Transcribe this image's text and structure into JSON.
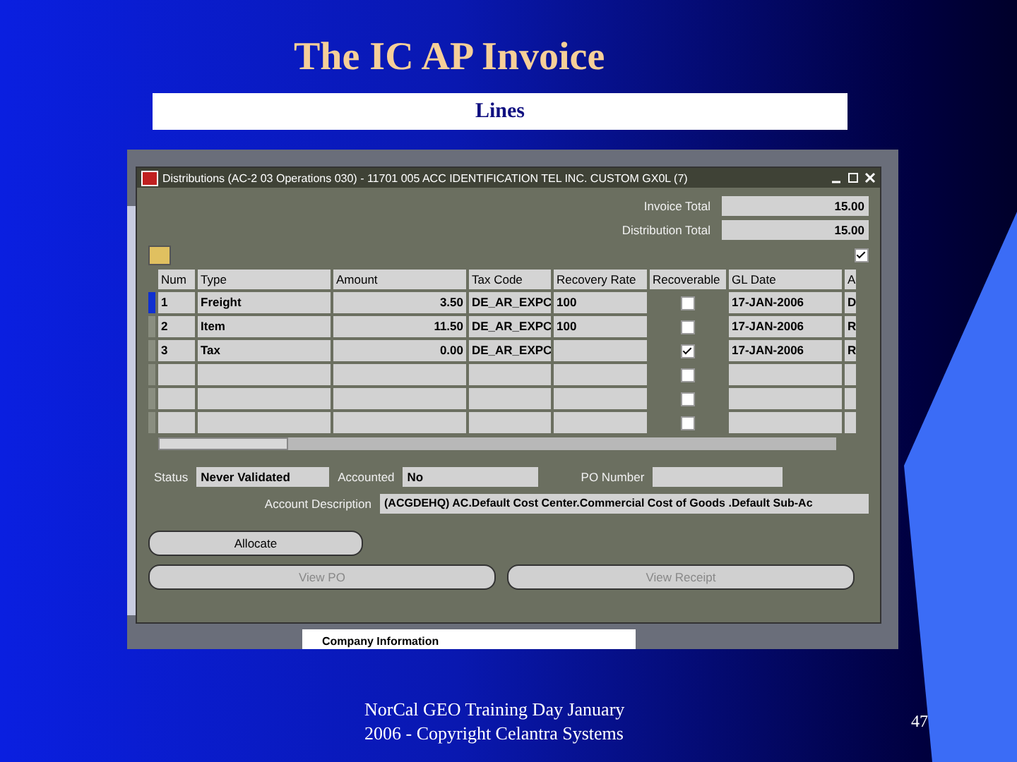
{
  "slide": {
    "title": "The IC AP Invoice",
    "subtitle": "Lines",
    "footer_lines": [
      "NorCal GEO Training Day January",
      "2006 -  Copyright Celantra Systems"
    ],
    "page_number": "47"
  },
  "background_app": {
    "tree_item": "Company Information"
  },
  "window": {
    "title": "Distributions (AC-2 03 Operations 030) - 11701 005 ACC IDENTIFICATION TEL INC. CUSTOM GX0L (7)",
    "totals": [
      {
        "label": "Invoice Total",
        "value": "15.00"
      },
      {
        "label": "Distribution Total",
        "value": "15.00"
      }
    ],
    "header_checked": true
  },
  "table": {
    "columns": [
      "Num",
      "Type",
      "Amount",
      "Tax Code",
      "Recovery Rate",
      "Recoverable",
      "GL Date",
      "A"
    ],
    "rows": [
      {
        "num": "1",
        "type": "Freight",
        "amount": "3.50",
        "tax_code": "DE_AR_EXPC",
        "recovery_rate": "100",
        "recoverable": false,
        "gl_date": "17-JAN-2006",
        "column_8": "D",
        "selected": true
      },
      {
        "num": "2",
        "type": "Item",
        "amount": "11.50",
        "tax_code": "DE_AR_EXPC",
        "recovery_rate": "100",
        "recoverable": false,
        "gl_date": "17-JAN-2006",
        "column_8": "R",
        "selected": false
      },
      {
        "num": "3",
        "type": "Tax",
        "amount": "0.00",
        "tax_code": "DE_AR_EXPC",
        "recoverable": true,
        "gl_date": "17-JAN-2006",
        "column_8": "R",
        "selected": false
      },
      {
        "recoverable": false,
        "selected": false
      },
      {
        "recoverable": false,
        "selected": false
      },
      {
        "recoverable": false,
        "selected": false
      }
    ]
  },
  "fields": [
    {
      "label": "Status",
      "value": "Never Validated"
    },
    {
      "label": "Accounted",
      "value": "No"
    },
    {
      "label": "PO Number"
    }
  ],
  "account_description": {
    "label": "Account Description",
    "value": "(ACGDEHQ) AC.Default Cost Center.Commercial Cost of Goods .Default Sub-Ac"
  },
  "buttons": [
    {
      "label": "Allocate",
      "disabled": false
    },
    {
      "label": "View PO",
      "disabled": true
    },
    {
      "label": "View Receipt",
      "disabled": true
    }
  ]
}
